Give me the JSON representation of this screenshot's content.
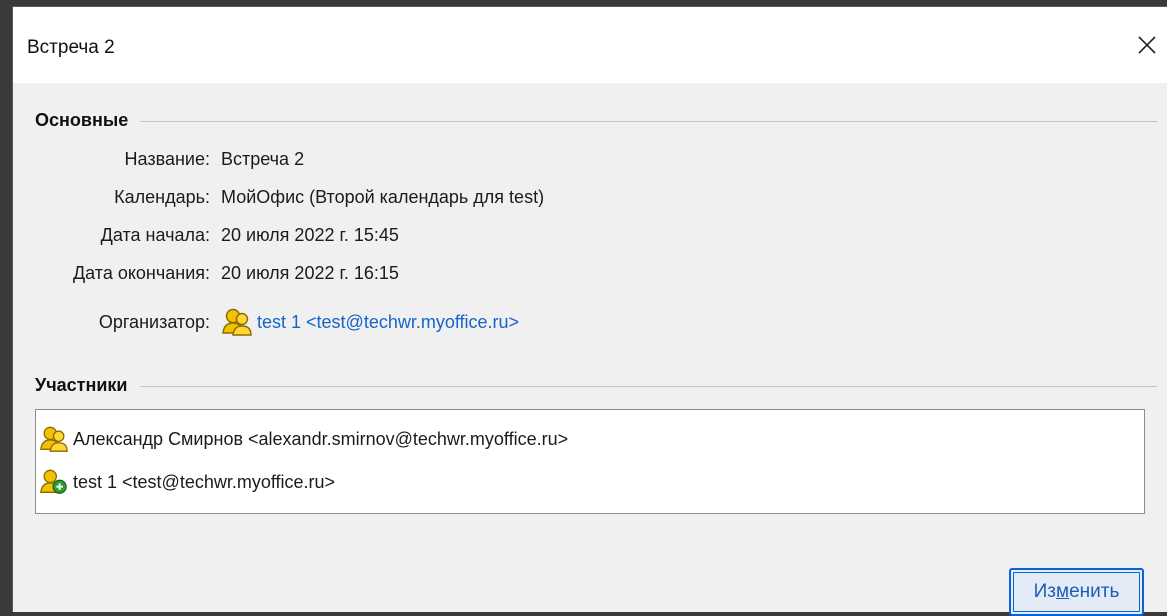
{
  "window": {
    "title": "Встреча 2",
    "close_icon": "close-icon"
  },
  "general": {
    "section_label": "Основные",
    "fields": {
      "name_label": "Название:",
      "name_value": "Встреча 2",
      "calendar_label": "Календарь:",
      "calendar_value": "МойОфис (Второй календарь для test)",
      "start_label": "Дата начала:",
      "start_value": "20 июля 2022 г. 15:45",
      "end_label": "Дата окончания:",
      "end_value": "20 июля 2022 г. 16:15",
      "organizer_label": "Организатор:",
      "organizer_value": "test 1 <test@techwr.myoffice.ru>",
      "organizer_icon": "person-icon"
    }
  },
  "participants": {
    "section_label": "Участники",
    "items": [
      {
        "text": "Александр Смирнов <alexandr.smirnov@techwr.myoffice.ru>",
        "icon": "person-icon"
      },
      {
        "text": "test 1 <test@techwr.myoffice.ru>",
        "icon": "person-accepted-icon"
      }
    ]
  },
  "actions": {
    "edit_prefix": "Из",
    "edit_mnemonic": "м",
    "edit_suffix": "енить"
  },
  "colors": {
    "link": "#1464c8",
    "accent": "#0a64d2",
    "person_icon_fill": "#f2c200",
    "accepted_badge": "#2e9d2e"
  }
}
